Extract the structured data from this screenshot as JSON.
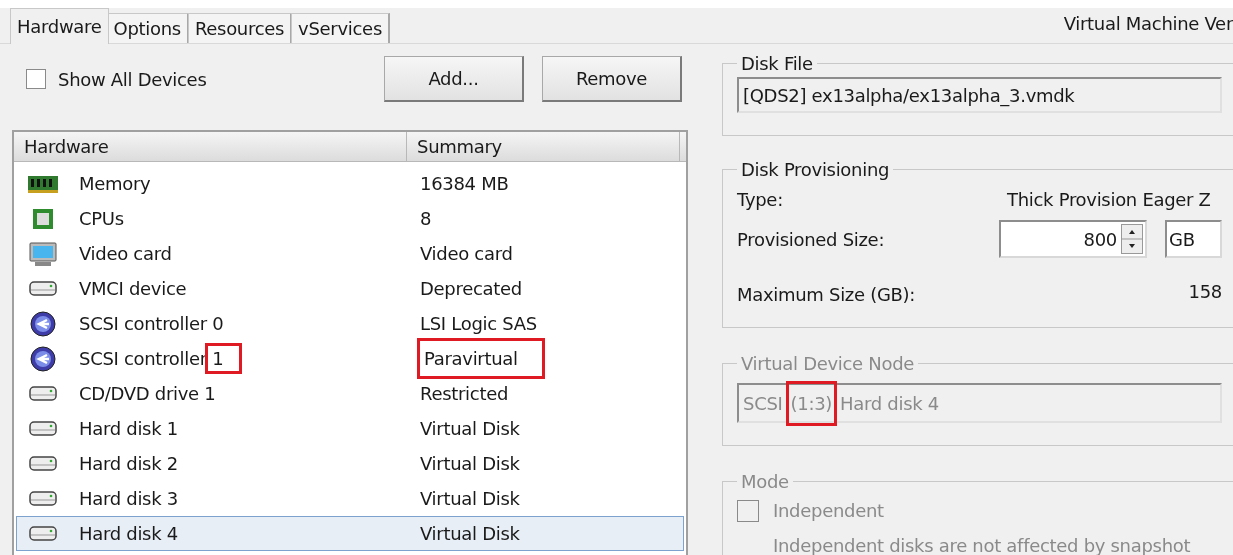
{
  "tabs": [
    {
      "label": "Hardware",
      "selected": true
    },
    {
      "label": "Options",
      "selected": false
    },
    {
      "label": "Resources",
      "selected": false
    },
    {
      "label": "vServices",
      "selected": false
    }
  ],
  "header_title": "Virtual Machine Ver",
  "show_all_devices": {
    "label": "Show All Devices",
    "checked": false
  },
  "buttons": [
    "Add...",
    "Remove"
  ],
  "table": {
    "columns": [
      "Hardware",
      "Summary"
    ],
    "rows": [
      {
        "kind": "memory",
        "name": "Memory",
        "summary": "16384 MB",
        "selected": false
      },
      {
        "kind": "cpu",
        "name": "CPUs",
        "summary": "8",
        "selected": false
      },
      {
        "kind": "monitor",
        "name": "Video card",
        "summary": "Video card",
        "selected": false
      },
      {
        "kind": "drive",
        "name": "VMCI device",
        "summary": "Deprecated",
        "selected": false
      },
      {
        "kind": "controller",
        "name": "SCSI controller 0",
        "summary": "LSI Logic SAS",
        "selected": false
      },
      {
        "kind": "controller",
        "name": "SCSI controller 1",
        "summary": "Paravirtual",
        "selected": false,
        "name_highlight": true,
        "summary_highlight": true
      },
      {
        "kind": "drive",
        "name": "CD/DVD drive 1",
        "summary": "Restricted",
        "selected": false
      },
      {
        "kind": "drive",
        "name": "Hard disk 1",
        "summary": "Virtual Disk",
        "selected": false
      },
      {
        "kind": "drive",
        "name": "Hard disk 2",
        "summary": "Virtual Disk",
        "selected": false
      },
      {
        "kind": "drive",
        "name": "Hard disk 3",
        "summary": "Virtual Disk",
        "selected": false
      },
      {
        "kind": "drive",
        "name": "Hard disk 4",
        "summary": "Virtual Disk",
        "selected": true
      }
    ]
  },
  "disk_file": {
    "title": "Disk File",
    "value": "[QDS2] ex13alpha/ex13alpha_3.vmdk"
  },
  "disk_provisioning": {
    "title": "Disk Provisioning",
    "type_label": "Type:",
    "type_value": "Thick Provision Eager Z",
    "size_label": "Provisioned Size:",
    "size_value": "800",
    "unit": "GB",
    "max_label": "Maximum Size (GB):",
    "max_value": "158"
  },
  "virtual_device_node": {
    "title": "Virtual Device Node",
    "disabled": true,
    "parts": [
      {
        "text": "SCSI",
        "highlighted": false
      },
      {
        "text": "(1:3)",
        "highlighted": true
      },
      {
        "text": "Hard disk 4",
        "highlighted": false
      }
    ]
  },
  "mode": {
    "title": "Mode",
    "independent": {
      "label": "Independent",
      "checked": false,
      "disabled": true
    },
    "note": "Independent disks are not affected by snapshot"
  }
}
